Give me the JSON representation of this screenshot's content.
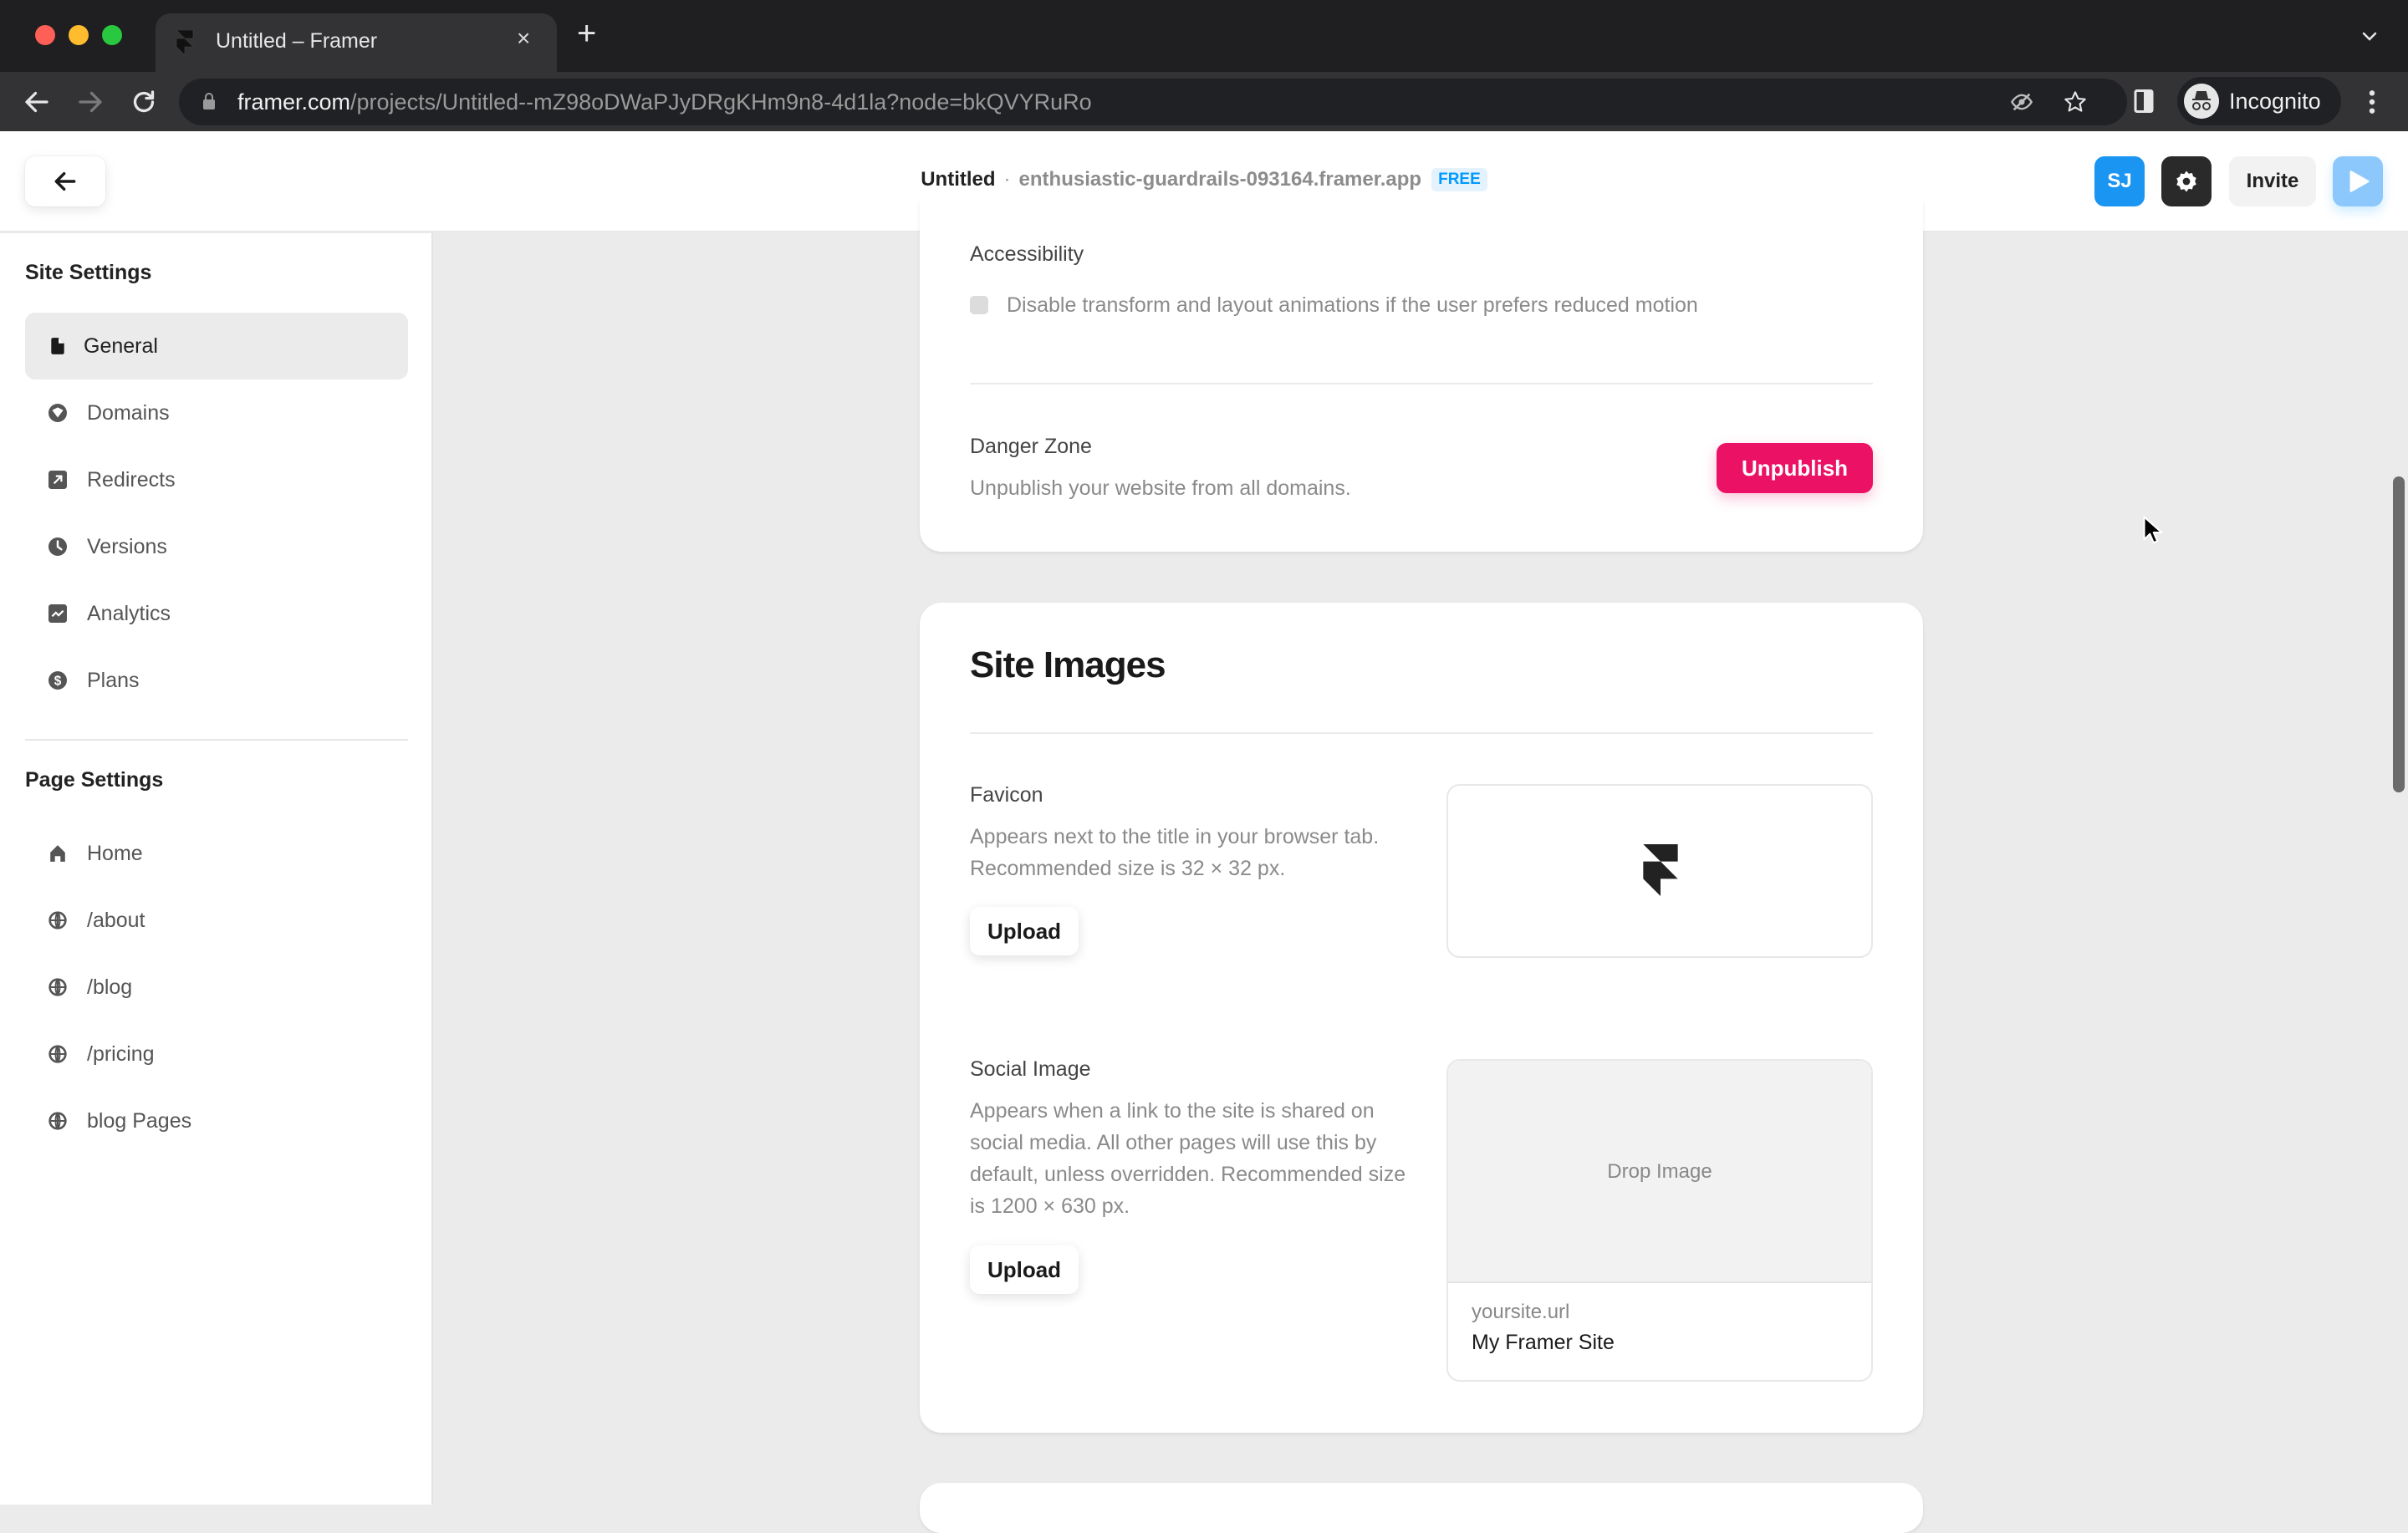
{
  "browser": {
    "tab_title": "Untitled – Framer",
    "tab_close": "×",
    "new_tab": "+",
    "url_host": "framer.com",
    "url_path": "/projects/Untitled--mZ98oDWaPJyDRgKHm9n8-4d1la?node=bkQVYRuRo",
    "profile_label": "Incognito",
    "colors": {
      "close": "#fe5f57",
      "minimize": "#febc2e",
      "maximize": "#28c840"
    }
  },
  "header": {
    "project_name": "Untitled",
    "separator": "·",
    "domain": "enthusiastic-guardrails-093164.framer.app",
    "plan_badge": "FREE",
    "avatar_initials": "SJ",
    "invite_label": "Invite"
  },
  "sidebar": {
    "site_settings_title": "Site Settings",
    "site_items": [
      {
        "label": "General",
        "icon": "document-icon",
        "active": true
      },
      {
        "label": "Domains",
        "icon": "globe-filled-icon"
      },
      {
        "label": "Redirects",
        "icon": "redirect-arrow-icon"
      },
      {
        "label": "Versions",
        "icon": "clock-icon"
      },
      {
        "label": "Analytics",
        "icon": "chart-icon"
      },
      {
        "label": "Plans",
        "icon": "dollar-icon"
      }
    ],
    "page_settings_title": "Page Settings",
    "page_items": [
      {
        "label": "Home",
        "icon": "home-icon"
      },
      {
        "label": "/about",
        "icon": "globe-icon"
      },
      {
        "label": "/blog",
        "icon": "globe-icon"
      },
      {
        "label": "/pricing",
        "icon": "globe-icon"
      },
      {
        "label": "blog Pages",
        "icon": "globe-icon"
      }
    ]
  },
  "main": {
    "accessibility": {
      "label": "Accessibility",
      "checkbox_label": "Disable transform and layout animations if the user prefers reduced motion",
      "checked": false
    },
    "danger_zone": {
      "label": "Danger Zone",
      "description": "Unpublish your website from all domains.",
      "button": "Unpublish",
      "button_color": "#eb1266"
    },
    "site_images": {
      "title": "Site Images",
      "favicon": {
        "label": "Favicon",
        "description": "Appears next to the title in your browser tab. Recommended size is 32 × 32 px.",
        "button": "Upload"
      },
      "social_image": {
        "label": "Social Image",
        "description": "Appears when a link to the site is shared on social media. All other pages will use this by default, unless overridden. Recommended size is 1200 × 630 px.",
        "button": "Upload",
        "drop_placeholder": "Drop Image",
        "preview_url": "yoursite.url",
        "preview_title": "My Framer Site"
      }
    }
  }
}
